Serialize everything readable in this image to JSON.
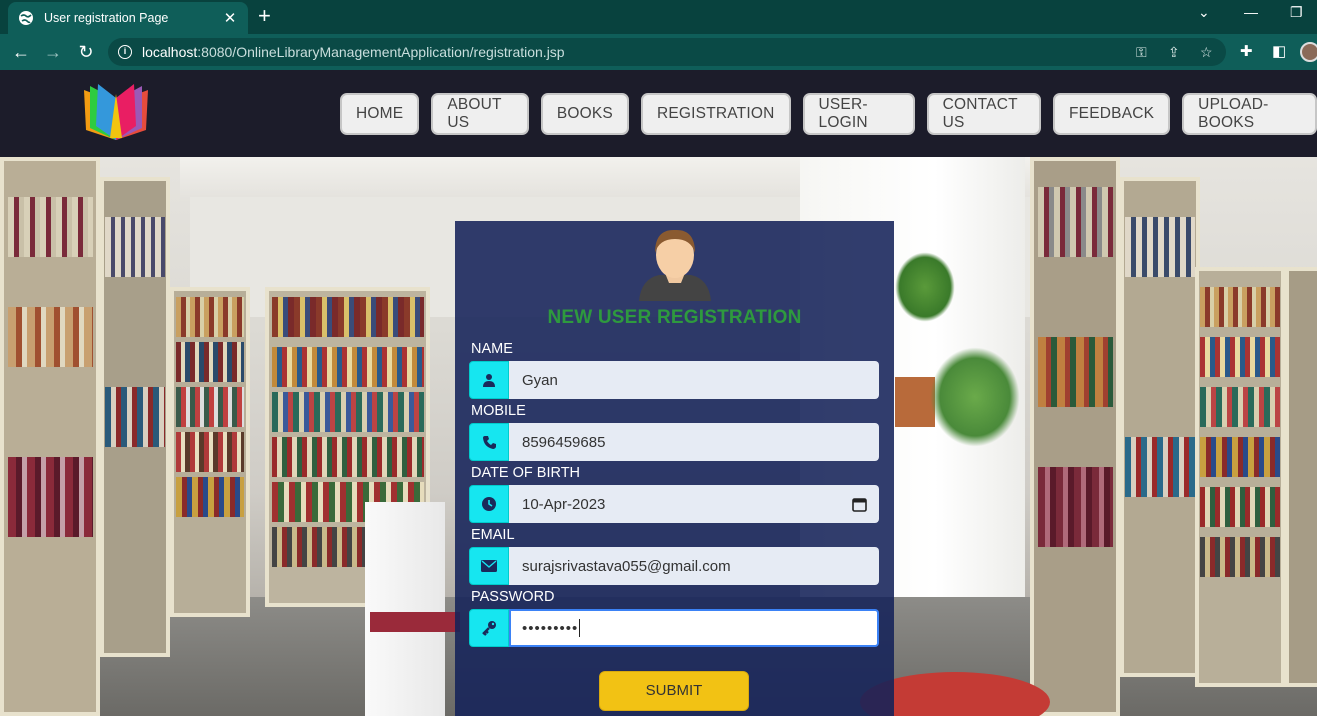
{
  "browser": {
    "tab_title": "User registration Page",
    "url_host": "localhost",
    "url_rest": ":8080/OnlineLibraryManagementApplication/registration.jsp"
  },
  "site": {
    "nav": [
      "HOME",
      "ABOUT US",
      "BOOKS",
      "REGISTRATION",
      "USER-LOGIN",
      "CONTACT US",
      "FEEDBACK",
      "UPLOAD-BOOKS"
    ]
  },
  "form": {
    "title": "NEW USER REGISTRATION",
    "name_label": "NAME",
    "name_value": "Gyan",
    "mobile_label": "MOBILE",
    "mobile_value": "8596459685",
    "dob_label": "DATE OF BIRTH",
    "dob_value": "10-Apr-2023",
    "email_label": "EMAIL",
    "email_value": "surajsrivastava055@gmail.com",
    "password_label": "PASSWORD",
    "password_value": "•••••••••",
    "submit_label": "SUBMIT"
  },
  "colors": {
    "panel": "#152259",
    "title_green": "#2e9a3e",
    "icon_cyan": "#16e6f0",
    "submit_yellow": "#f2c214"
  }
}
